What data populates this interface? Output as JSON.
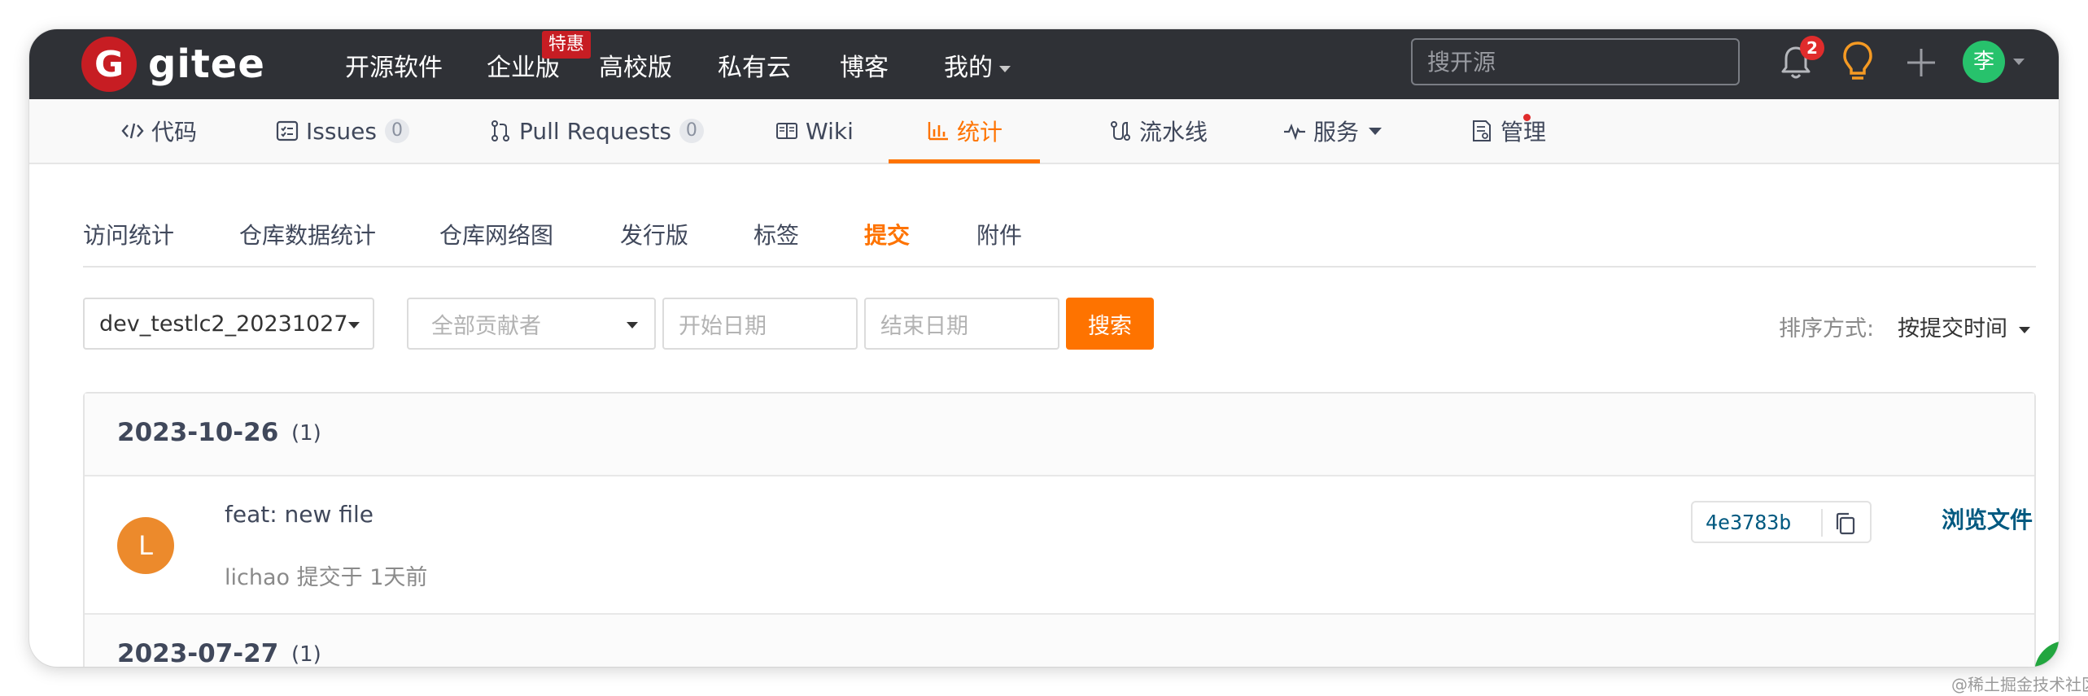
{
  "brand": {
    "logo_letter": "G",
    "name": "gitee"
  },
  "topnav": {
    "items": [
      "开源软件",
      "企业版",
      "高校版",
      "私有云",
      "博客",
      "我的"
    ],
    "promo_badge": "特惠",
    "search_placeholder": "搜开源",
    "notification_count": "2",
    "user_initial": "李"
  },
  "repo_tabs": {
    "code": "代码",
    "issues": "Issues",
    "issues_count": "0",
    "pull_requests": "Pull Requests",
    "pull_requests_count": "0",
    "wiki": "Wiki",
    "stats": "统计",
    "pipeline": "流水线",
    "services": "服务",
    "manage": "管理"
  },
  "sub_tabs": [
    "访问统计",
    "仓库数据统计",
    "仓库网络图",
    "发行版",
    "标签",
    "提交",
    "附件"
  ],
  "active_sub_tab": "提交",
  "filters": {
    "branch": "dev_testlc2_20231027",
    "contributor_placeholder": "全部贡献者",
    "start_date_placeholder": "开始日期",
    "end_date_placeholder": "结束日期",
    "search_button": "搜索",
    "sort_label": "排序方式:",
    "sort_value": "按提交时间"
  },
  "commit_groups": [
    {
      "date": "2023-10-26",
      "count": "(1)",
      "commits": [
        {
          "avatar_letter": "L",
          "message": "feat: new file",
          "meta": "lichao 提交于 1天前",
          "sha": "4e3783b",
          "browse_label": "浏览文件"
        }
      ]
    },
    {
      "date": "2023-07-27",
      "count": "(1)"
    }
  ],
  "watermark": "@稀土掘金技术社区",
  "colors": {
    "accent": "#fe7300",
    "topbar": "#2f3136",
    "link": "#005980",
    "brand_red": "#c71d23"
  }
}
